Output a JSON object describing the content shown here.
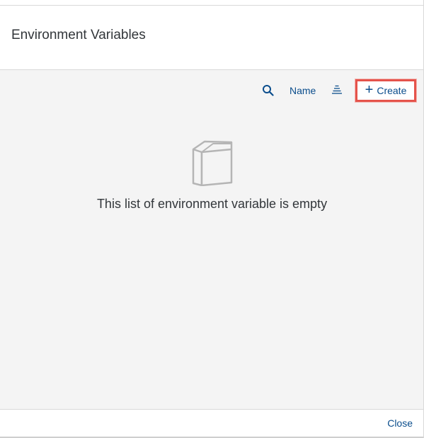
{
  "dialog": {
    "title": "Environment Variables",
    "toolbar": {
      "search_icon": "search-icon",
      "sort_field_label": "Name",
      "sort_icon": "sort-ascending-icon",
      "create_label": "Create",
      "create_icon": "plus-icon"
    },
    "empty_state": {
      "icon": "empty-list-book-icon",
      "message": "This list of environment variable is empty"
    },
    "footer": {
      "close_label": "Close"
    }
  },
  "colors": {
    "accent": "#0a4d8c",
    "highlight_border": "#e5534b",
    "content_bg": "#f4f4f4",
    "text": "#32363a"
  }
}
